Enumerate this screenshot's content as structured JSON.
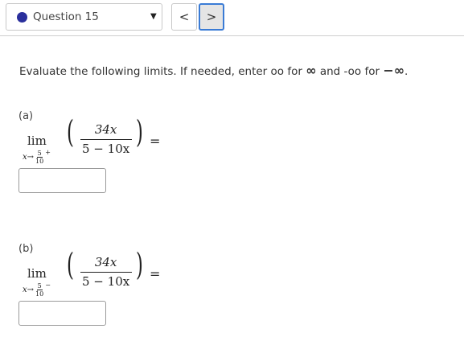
{
  "header": {
    "question_label": "Question 15",
    "caret": "▼",
    "prev": "<",
    "next": ">"
  },
  "instructions": {
    "text_before": "Evaluate the following limits. If needed, enter oo for ",
    "infinity": "∞",
    "text_middle": " and -oo for ",
    "neg_infinity": "−∞",
    "text_after": "."
  },
  "parts": [
    {
      "label": "(a)",
      "lim": "lim",
      "var": "x",
      "arrow": "→",
      "approach_num": "5",
      "approach_den": "10",
      "side": "+",
      "numerator": "34x",
      "denominator": "5 − 10x",
      "equals": "=",
      "answer": ""
    },
    {
      "label": "(b)",
      "lim": "lim",
      "var": "x",
      "arrow": "→",
      "approach_num": "5",
      "approach_den": "10",
      "side": "−",
      "numerator": "34x",
      "denominator": "5 − 10x",
      "equals": "=",
      "answer": ""
    }
  ]
}
